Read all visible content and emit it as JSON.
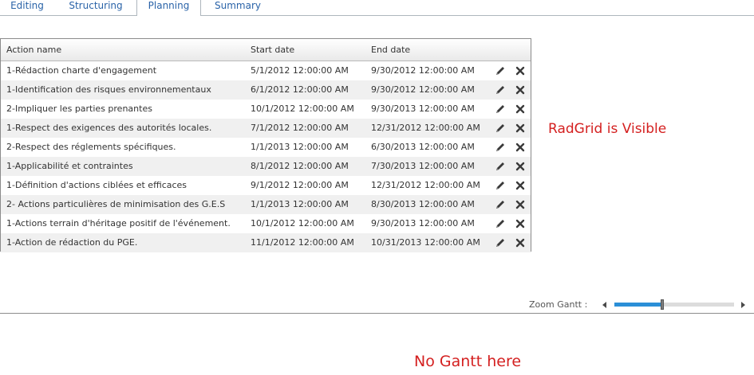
{
  "tabs": [
    {
      "label": "Editing"
    },
    {
      "label": "Structuring"
    },
    {
      "label": "Planning"
    },
    {
      "label": "Summary"
    }
  ],
  "selected_tab": "Planning",
  "grid": {
    "columns": {
      "name": "Action name",
      "start": "Start date",
      "end": "End date"
    },
    "rows": [
      {
        "name": "1-Rédaction charte d'engagement",
        "start": "5/1/2012 12:00:00 AM",
        "end": "9/30/2012 12:00:00 AM"
      },
      {
        "name": "1-Identification des risques environnementaux",
        "start": "6/1/2012 12:00:00 AM",
        "end": "9/30/2012 12:00:00 AM"
      },
      {
        "name": "2-Impliquer les parties prenantes",
        "start": "10/1/2012 12:00:00 AM",
        "end": "9/30/2013 12:00:00 AM"
      },
      {
        "name": "1-Respect des exigences des autorités locales.",
        "start": "7/1/2012 12:00:00 AM",
        "end": "12/31/2012 12:00:00 AM"
      },
      {
        "name": "2-Respect des réglements spécifiques.",
        "start": "1/1/2013 12:00:00 AM",
        "end": "6/30/2013 12:00:00 AM"
      },
      {
        "name": "1-Applicabilité et contraintes",
        "start": "8/1/2012 12:00:00 AM",
        "end": "7/30/2013 12:00:00 AM"
      },
      {
        "name": "1-Définition d'actions ciblées et efficaces",
        "start": "9/1/2012 12:00:00 AM",
        "end": "12/31/2012 12:00:00 AM"
      },
      {
        "name": "2- Actions particulières de minimisation des G.E.S",
        "start": "1/1/2013 12:00:00 AM",
        "end": "8/30/2013 12:00:00 AM"
      },
      {
        "name": "1-Actions terrain d'héritage positif de l'événement.",
        "start": "10/1/2012 12:00:00 AM",
        "end": "9/30/2013 12:00:00 AM"
      },
      {
        "name": "1-Action de rédaction du PGE.",
        "start": "11/1/2012 12:00:00 AM",
        "end": "10/31/2013 12:00:00 AM"
      }
    ]
  },
  "radgrid_message": "RadGrid is Visible",
  "zoom": {
    "label": "Zoom Gantt :",
    "level": 0.4
  },
  "gantt_message": "No Gantt here",
  "colors": {
    "accent": "#2b8fd7",
    "message": "#d42020",
    "tab_text": "#2a63a8"
  },
  "icons": {
    "edit": "pencil-icon",
    "delete": "close-icon",
    "zoom_left": "triangle-left-icon",
    "zoom_right": "triangle-right-icon"
  }
}
